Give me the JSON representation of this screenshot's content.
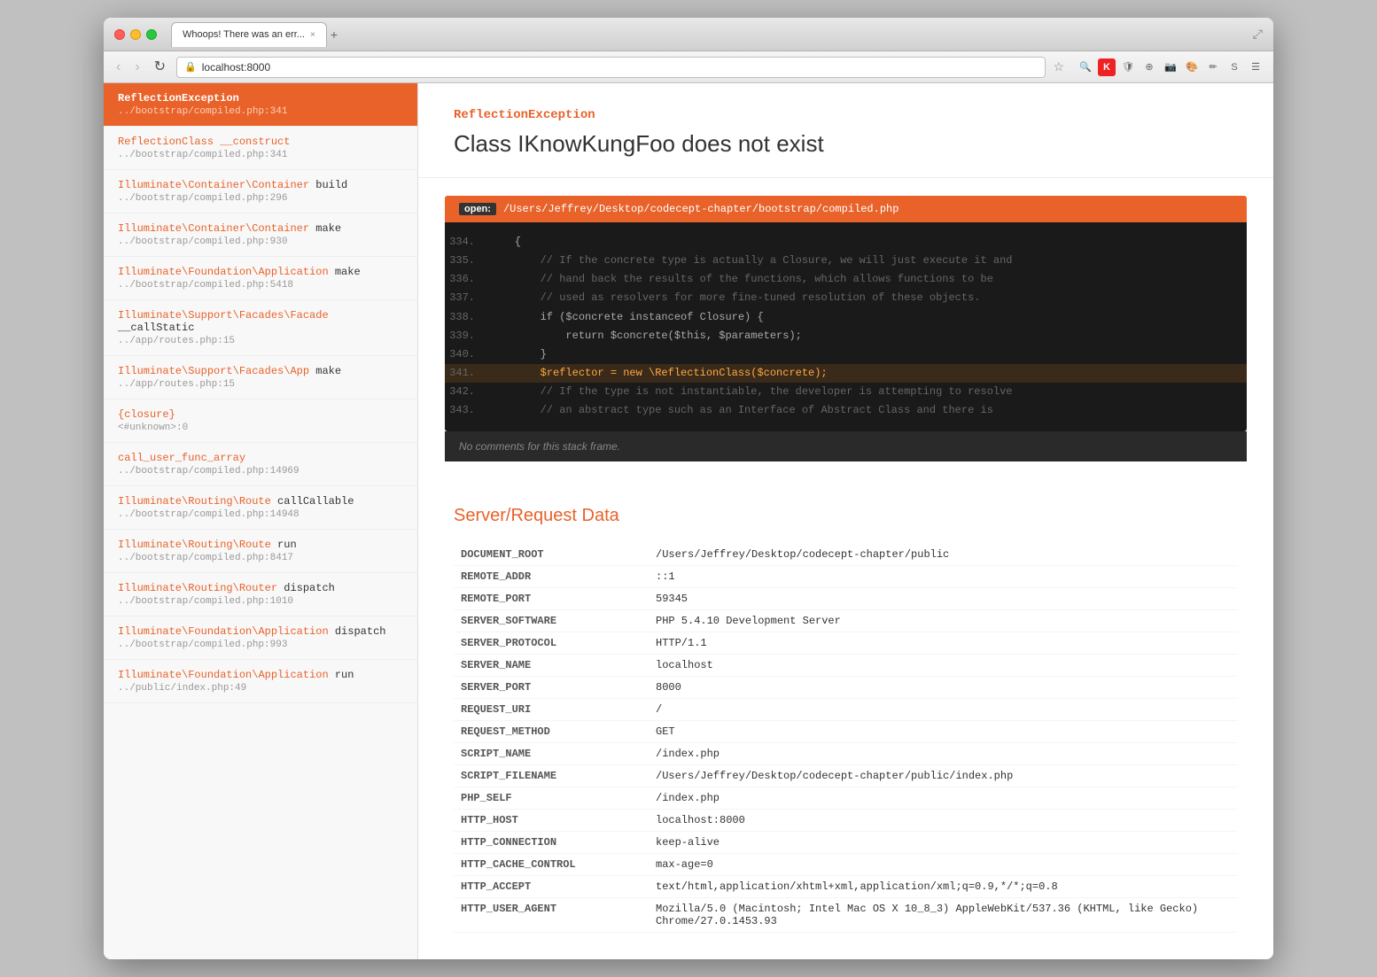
{
  "browser": {
    "tab_title": "Whoops! There was an err...",
    "tab_close": "×",
    "url": "localhost:8000",
    "back_btn": "‹",
    "forward_btn": "›",
    "refresh_btn": "↻"
  },
  "error": {
    "type": "ReflectionException",
    "message": "Class IKnowKungFoo does not exist"
  },
  "code_viewer": {
    "open_label": "open:",
    "file_path": "/Users/Jeffrey/Desktop/codecept-chapter/bootstrap/compiled.php",
    "no_comments": "No comments for this stack frame.",
    "lines": [
      {
        "num": "334.",
        "code": "    {",
        "active": false
      },
      {
        "num": "335.",
        "code": "        // If the concrete type is actually a Closure, we will just execute it and",
        "active": false,
        "comment": true
      },
      {
        "num": "336.",
        "code": "        // hand back the results of the functions, which allows functions to be",
        "active": false,
        "comment": true
      },
      {
        "num": "337.",
        "code": "        // used as resolvers for more fine-tuned resolution of these objects.",
        "active": false,
        "comment": true
      },
      {
        "num": "338.",
        "code": "        if ($concrete instanceof Closure) {",
        "active": false
      },
      {
        "num": "339.",
        "code": "            return $concrete($this, $parameters);",
        "active": false
      },
      {
        "num": "340.",
        "code": "        }",
        "active": false
      },
      {
        "num": "341.",
        "code": "        $reflector = new \\ReflectionClass($concrete);",
        "active": true
      },
      {
        "num": "342.",
        "code": "        // If the type is not instantiable, the developer is attempting to resolve",
        "active": false,
        "comment": true
      },
      {
        "num": "343.",
        "code": "        // an abstract type such as an Interface of Abstract Class and there is",
        "active": false,
        "comment": true
      }
    ]
  },
  "stack_trace": [
    {
      "class": "ReflectionException",
      "file": "../bootstrap/compiled.php:341",
      "active": true,
      "namespace": ""
    },
    {
      "class": "ReflectionClass __construct",
      "file": "../bootstrap/compiled.php:341",
      "active": false,
      "namespace": ""
    },
    {
      "class": "Illuminate\\Container\\Container build",
      "file": "../bootstrap/compiled.php:296",
      "active": false,
      "namespace": "Illuminate\\Container\\"
    },
    {
      "class": "Illuminate\\Container\\Container make",
      "file": "../bootstrap/compiled.php:930",
      "active": false,
      "namespace": "Illuminate\\Container\\"
    },
    {
      "class": "Illuminate\\Foundation\\Application make",
      "file": "../bootstrap/compiled.php:5418",
      "active": false,
      "namespace": "Illuminate\\Foundation\\"
    },
    {
      "class": "Illuminate\\Support\\Facades\\Facade __callStatic",
      "file": "../app/routes.php:15",
      "active": false,
      "namespace": "Illuminate\\Support\\Facades\\"
    },
    {
      "class": "Illuminate\\Support\\Facades\\App make",
      "file": "../app/routes.php:15",
      "active": false,
      "namespace": "Illuminate\\Support\\Facades\\"
    },
    {
      "class": "{closure}",
      "file": "<#unknown>:0",
      "active": false,
      "namespace": ""
    },
    {
      "class": "call_user_func_array",
      "file": "../bootstrap/compiled.php:14969",
      "active": false,
      "namespace": ""
    },
    {
      "class": "Illuminate\\Routing\\Route callCallable",
      "file": "../bootstrap/compiled.php:14948",
      "active": false,
      "namespace": "Illuminate\\Routing\\"
    },
    {
      "class": "Illuminate\\Routing\\Route run",
      "file": "../bootstrap/compiled.php:8417",
      "active": false,
      "namespace": "Illuminate\\Routing\\"
    },
    {
      "class": "Illuminate\\Routing\\Router dispatch",
      "file": "../bootstrap/compiled.php:1010",
      "active": false,
      "namespace": "Illuminate\\Routing\\"
    },
    {
      "class": "Illuminate\\Foundation\\Application dispatch",
      "file": "../bootstrap/compiled.php:993",
      "active": false,
      "namespace": "Illuminate\\Foundation\\"
    },
    {
      "class": "Illuminate\\Foundation\\Application run",
      "file": "../public/index.php:49",
      "active": false,
      "namespace": "Illuminate\\Foundation\\"
    }
  ],
  "server_data": {
    "title": "Server/Request Data",
    "rows": [
      {
        "key": "DOCUMENT_ROOT",
        "value": "/Users/Jeffrey/Desktop/codecept-chapter/public"
      },
      {
        "key": "REMOTE_ADDR",
        "value": "::1"
      },
      {
        "key": "REMOTE_PORT",
        "value": "59345"
      },
      {
        "key": "SERVER_SOFTWARE",
        "value": "PHP 5.4.10 Development Server"
      },
      {
        "key": "SERVER_PROTOCOL",
        "value": "HTTP/1.1"
      },
      {
        "key": "SERVER_NAME",
        "value": "localhost"
      },
      {
        "key": "SERVER_PORT",
        "value": "8000"
      },
      {
        "key": "REQUEST_URI",
        "value": "/"
      },
      {
        "key": "REQUEST_METHOD",
        "value": "GET"
      },
      {
        "key": "SCRIPT_NAME",
        "value": "/index.php"
      },
      {
        "key": "SCRIPT_FILENAME",
        "value": "/Users/Jeffrey/Desktop/codecept-chapter/public/index.php"
      },
      {
        "key": "PHP_SELF",
        "value": "/index.php"
      },
      {
        "key": "HTTP_HOST",
        "value": "localhost:8000"
      },
      {
        "key": "HTTP_CONNECTION",
        "value": "keep-alive"
      },
      {
        "key": "HTTP_CACHE_CONTROL",
        "value": "max-age=0"
      },
      {
        "key": "HTTP_ACCEPT",
        "value": "text/html,application/xhtml+xml,application/xml;q=0.9,*/*;q=0.8"
      },
      {
        "key": "HTTP_USER_AGENT",
        "value": "Mozilla/5.0 (Macintosh; Intel Mac OS X 10_8_3) AppleWebKit/537.36 (KHTML, like Gecko) Chrome/27.0.1453.93"
      }
    ]
  }
}
